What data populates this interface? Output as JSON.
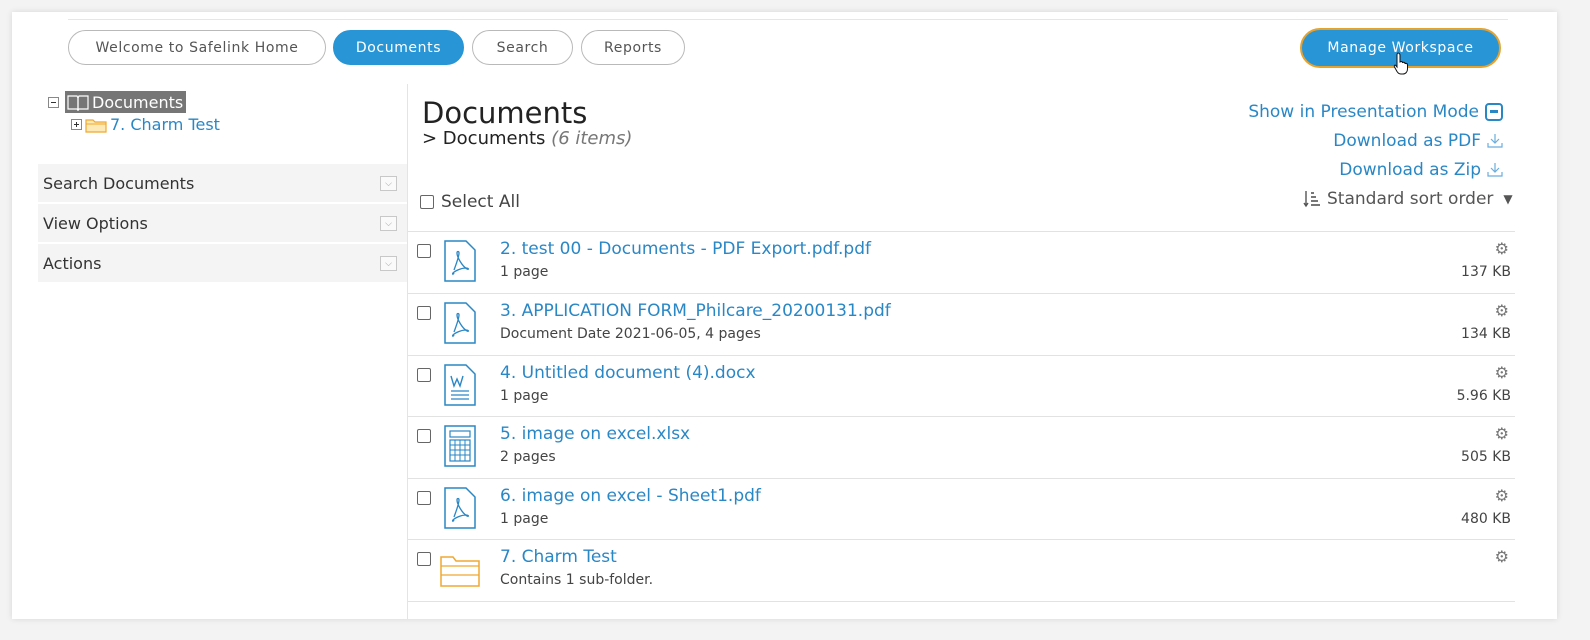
{
  "nav": {
    "tabs": [
      {
        "label": "Welcome to Safelink Home",
        "active": false
      },
      {
        "label": "Documents",
        "active": true
      },
      {
        "label": "Search",
        "active": false
      },
      {
        "label": "Reports",
        "active": false
      }
    ],
    "manage_label": "Manage Workspace"
  },
  "tree": {
    "root_label": "Documents",
    "child_label": "7. Charm Test"
  },
  "sidebar": {
    "sections": [
      {
        "label": "Search Documents"
      },
      {
        "label": "View Options"
      },
      {
        "label": "Actions"
      }
    ]
  },
  "main": {
    "title": "Documents",
    "breadcrumb": "> Documents",
    "item_count": "(6 items)",
    "links": {
      "presentation": "Show in Presentation Mode",
      "pdf": "Download as PDF",
      "zip": "Download as Zip"
    },
    "select_all": "Select All",
    "sort_label": "Standard sort order",
    "items": [
      {
        "name": "2. test 00 - Documents - PDF Export.pdf.pdf",
        "meta": "1 page",
        "size": "137 KB",
        "icon": "pdf-icon"
      },
      {
        "name": "3. APPLICATION FORM_Philcare_20200131.pdf",
        "meta": "Document Date 2021-06-05, 4 pages",
        "size": "134 KB",
        "icon": "pdf-icon"
      },
      {
        "name": "4. Untitled document (4).docx",
        "meta": "1 page",
        "size": "5.96 KB",
        "icon": "word-icon"
      },
      {
        "name": "5. image on excel.xlsx",
        "meta": "2 pages",
        "size": "505 KB",
        "icon": "spreadsheet-icon"
      },
      {
        "name": "6. image on excel - Sheet1.pdf",
        "meta": "1 page",
        "size": "480 KB",
        "icon": "pdf-icon"
      },
      {
        "name": "7. Charm Test",
        "meta": "Contains 1 sub-folder.",
        "size": "",
        "icon": "folder-icon"
      }
    ]
  },
  "colors": {
    "accent": "#2795d6",
    "link": "#2a87c6",
    "focus_ring": "#e7a22c",
    "folder": "#f0a830"
  }
}
